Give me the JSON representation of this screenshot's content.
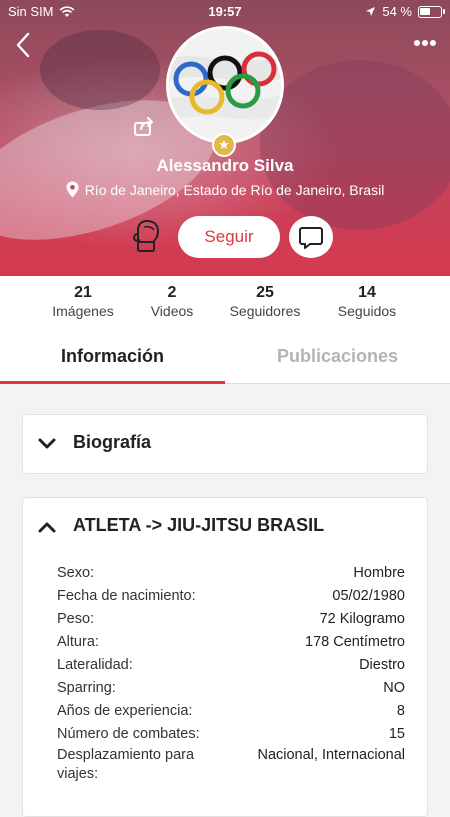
{
  "status_bar": {
    "carrier": "Sin SIM",
    "time": "19:57",
    "battery_pct": "54 %",
    "battery_level": 0.54
  },
  "profile": {
    "name": "Alessandro Silva",
    "location": "Río de Janeiro, Estado de Río de Janeiro, Brasil",
    "follow_label": "Seguir",
    "accent_color": "#e0373c",
    "badge_color": "#e1b94a"
  },
  "stats": [
    {
      "value": "21",
      "label": "Imágenes"
    },
    {
      "value": "2",
      "label": "Videos"
    },
    {
      "value": "25",
      "label": "Seguidores"
    },
    {
      "value": "14",
      "label": "Seguidos"
    }
  ],
  "tabs": [
    {
      "label": "Información",
      "active": true
    },
    {
      "label": "Publicaciones",
      "active": false
    }
  ],
  "sections": {
    "bio": {
      "title": "Biografía",
      "expanded": false
    },
    "athlete": {
      "title": "ATLETA -> JIU-JITSU BRASIL",
      "expanded": true,
      "fields": [
        {
          "key": "Sexo:",
          "value": "Hombre"
        },
        {
          "key": "Fecha de nacimiento:",
          "value": "05/02/1980"
        },
        {
          "key": "Peso:",
          "value": "72 Kilogramo"
        },
        {
          "key": "Altura:",
          "value": "178 Centímetro"
        },
        {
          "key": "Lateralidad:",
          "value": "Diestro"
        },
        {
          "key": "Sparring:",
          "value": "NO"
        },
        {
          "key": "Años de experiencia:",
          "value": "8"
        },
        {
          "key": "Número de combates:",
          "value": "15"
        },
        {
          "key": "Desplazamiento para viajes:",
          "value": "Nacional, Internacional"
        }
      ]
    }
  },
  "icons": [
    "back-icon",
    "more-icon",
    "share-icon",
    "star-icon",
    "location-pin-icon",
    "boxing-glove-icon",
    "chat-icon",
    "chevron-down-icon",
    "chevron-up-icon",
    "wifi-icon",
    "location-arrow-icon",
    "battery-icon"
  ]
}
